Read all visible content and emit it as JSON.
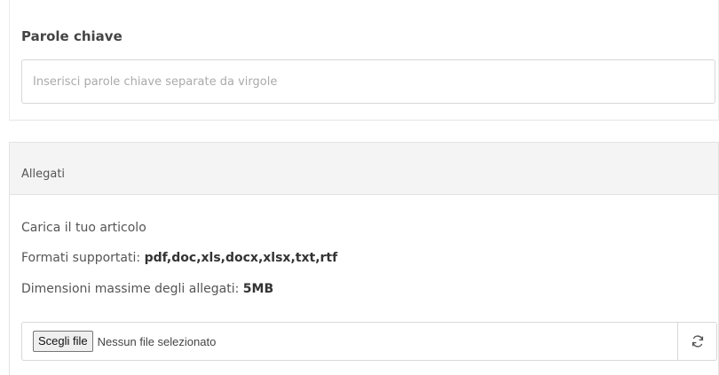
{
  "keywords": {
    "label": "Parole chiave",
    "placeholder": "Inserisci parole chiave separate da virgole",
    "value": ""
  },
  "attachments": {
    "title": "Allegati",
    "upload_text": "Carica il tuo articolo",
    "formats_label": "Formati supportati:",
    "formats_value": "pdf,doc,xls,docx,xlsx,txt,rtf",
    "max_size_label": "Dimensioni massime degli allegati:",
    "max_size_value": "5MB",
    "choose_file_label": "Scegli file",
    "no_file_text": "Nessun file selezionato",
    "refresh_icon": "refresh-icon"
  }
}
